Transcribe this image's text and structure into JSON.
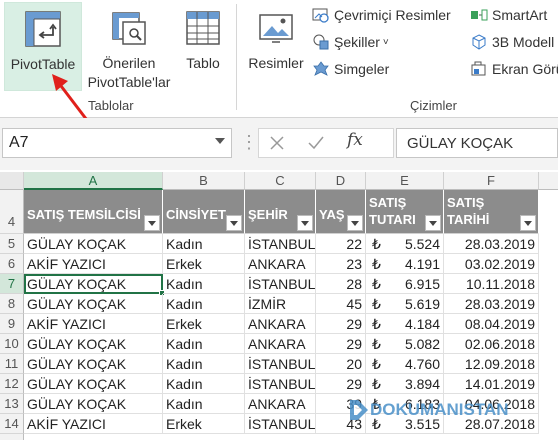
{
  "ribbon": {
    "tables_group": {
      "label": "Tablolar",
      "pivottable_label": "PivotTable",
      "recommended_line1": "Önerilen",
      "recommended_line2": "PivotTable'lar",
      "table_label": "Tablo"
    },
    "illustrations_group": {
      "label": "Çizimler",
      "pictures_label": "Resimler",
      "online_pictures_label": "Çevrimiçi Resimler",
      "shapes_label": "Şekiller",
      "icons_label": "Simgeler",
      "smartart_label": "SmartArt",
      "models3d_label": "3B Modell",
      "screenshot_label": "Ekran Görü"
    }
  },
  "formula_bar": {
    "name_box": "A7",
    "formula_value": "GÜLAY KOÇAK",
    "cancel_icon": "close-icon",
    "confirm_icon": "check-icon",
    "fx_label": "fx"
  },
  "sheet": {
    "columns": [
      "A",
      "B",
      "C",
      "D",
      "E",
      "F"
    ],
    "selected_column": "A",
    "selected_cell": "A7",
    "header_row_number": "4",
    "headers": [
      "SATIŞ TEMSİLCİSİ",
      "CİNSİYET",
      "ŞEHİR",
      "YAŞ",
      "SATIŞ TUTARI",
      "SATIŞ TARİHİ"
    ],
    "header_lines": {
      "e1": "SATIŞ",
      "e2": "TUTARI",
      "f1": "SATIŞ",
      "f2": "TARİHİ"
    },
    "currency_symbol": "₺",
    "rows": [
      {
        "n": "5",
        "a": "GÜLAY KOÇAK",
        "b": "Kadın",
        "c": "İSTANBUL",
        "d": "22",
        "e": "5.524",
        "f": "28.03.2019"
      },
      {
        "n": "6",
        "a": "AKİF YAZICI",
        "b": "Erkek",
        "c": "ANKARA",
        "d": "23",
        "e": "4.191",
        "f": "03.02.2019"
      },
      {
        "n": "7",
        "a": "GÜLAY KOÇAK",
        "b": "Kadın",
        "c": "İSTANBUL",
        "d": "28",
        "e": "6.915",
        "f": "10.11.2018"
      },
      {
        "n": "8",
        "a": "GÜLAY KOÇAK",
        "b": "Kadın",
        "c": "İZMİR",
        "d": "45",
        "e": "5.619",
        "f": "28.03.2019"
      },
      {
        "n": "9",
        "a": "AKİF YAZICI",
        "b": "Erkek",
        "c": "ANKARA",
        "d": "29",
        "e": "4.184",
        "f": "08.04.2019"
      },
      {
        "n": "10",
        "a": "GÜLAY KOÇAK",
        "b": "Kadın",
        "c": "ANKARA",
        "d": "29",
        "e": "5.082",
        "f": "02.06.2018"
      },
      {
        "n": "11",
        "a": "GÜLAY KOÇAK",
        "b": "Kadın",
        "c": "İSTANBUL",
        "d": "20",
        "e": "4.760",
        "f": "12.09.2018"
      },
      {
        "n": "12",
        "a": "GÜLAY KOÇAK",
        "b": "Kadın",
        "c": "İSTANBUL",
        "d": "29",
        "e": "3.894",
        "f": "14.01.2019"
      },
      {
        "n": "13",
        "a": "GÜLAY KOÇAK",
        "b": "Kadın",
        "c": "ANKARA",
        "d": "39",
        "e": "6.183",
        "f": "04.06.2018"
      },
      {
        "n": "14",
        "a": "AKİF YAZICI",
        "b": "Erkek",
        "c": "İSTANBUL",
        "d": "43",
        "e": "3.515",
        "f": "28.07.2018"
      }
    ]
  },
  "watermark": {
    "text": "DOKUMANISTAN"
  },
  "colors": {
    "header_fill": "#8c8c8c",
    "accent": "#217346",
    "pivot_highlight": "#d9efe4",
    "arrow": "#e0201b"
  }
}
